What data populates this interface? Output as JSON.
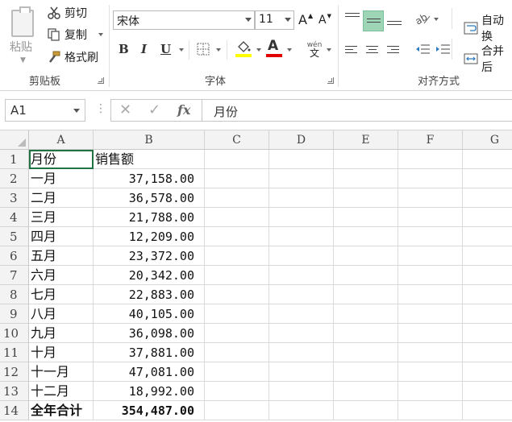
{
  "ribbon": {
    "clipboard": {
      "paste_label": "粘贴",
      "cut_label": "剪切",
      "copy_label": "复制",
      "format_painter_label": "格式刷",
      "group_label": "剪贴板"
    },
    "font": {
      "font_name": "宋体",
      "font_size": "11",
      "increase_label": "A",
      "decrease_label": "A",
      "bold_label": "B",
      "italic_label": "I",
      "underline_label": "U",
      "font_color_label": "A",
      "phonetic_label": "wén",
      "phonetic_sub": "文",
      "group_label": "字体",
      "fill_color": "#ffff00",
      "font_color": "#e00000"
    },
    "alignment": {
      "wrap_label": "自动换",
      "merge_label": "合并后",
      "group_label": "对齐方式"
    }
  },
  "formula_bar": {
    "name_box": "A1",
    "fx": "fx",
    "content": "月份"
  },
  "sheet": {
    "columns": [
      "A",
      "B",
      "C",
      "D",
      "E",
      "F",
      "G"
    ],
    "rows": [
      {
        "n": "1",
        "a": "月份",
        "b": ""
      },
      {
        "n": "2",
        "a": "一月",
        "b": "37,158.00"
      },
      {
        "n": "3",
        "a": "二月",
        "b": "36,578.00"
      },
      {
        "n": "4",
        "a": "三月",
        "b": "21,788.00"
      },
      {
        "n": "5",
        "a": "四月",
        "b": "12,209.00"
      },
      {
        "n": "6",
        "a": "五月",
        "b": "23,372.00"
      },
      {
        "n": "7",
        "a": "六月",
        "b": "20,342.00"
      },
      {
        "n": "8",
        "a": "七月",
        "b": "22,883.00"
      },
      {
        "n": "9",
        "a": "八月",
        "b": "40,105.00"
      },
      {
        "n": "10",
        "a": "九月",
        "b": "36,098.00"
      },
      {
        "n": "11",
        "a": "十月",
        "b": "37,881.00"
      },
      {
        "n": "12",
        "a": "十一月",
        "b": "47,081.00"
      },
      {
        "n": "13",
        "a": "十二月",
        "b": "18,992.00"
      },
      {
        "n": "14",
        "a": "全年合计",
        "b": "354,487.00"
      }
    ],
    "b1_header": "销售额",
    "accent": "#217346"
  }
}
